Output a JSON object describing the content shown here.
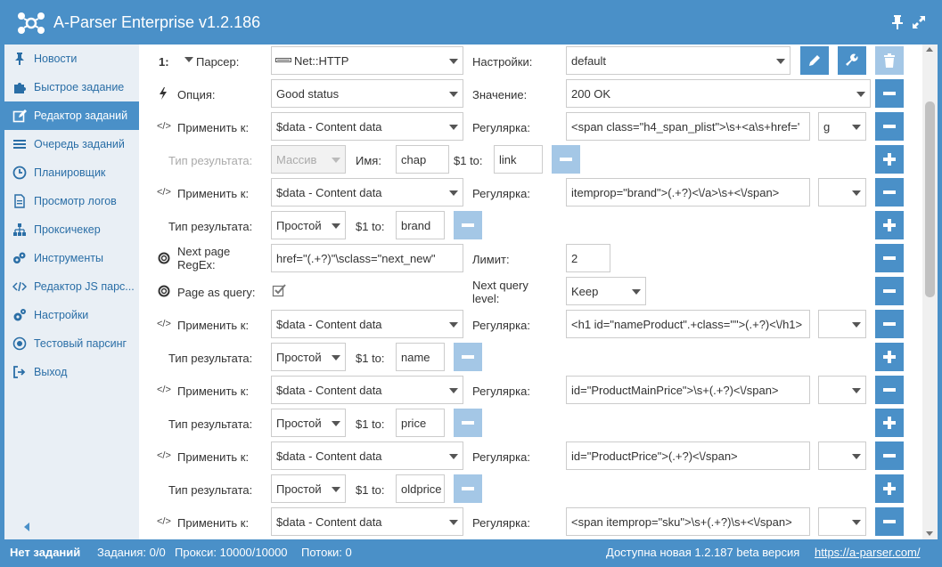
{
  "app": {
    "title": "A-Parser Enterprise v1.2.186"
  },
  "sidebar": {
    "items": [
      {
        "label": "Новости",
        "icon": "pin-icon"
      },
      {
        "label": "Быстрое задание",
        "icon": "puzzle-icon"
      },
      {
        "label": "Редактор заданий",
        "icon": "edit-icon",
        "active": true
      },
      {
        "label": "Очередь заданий",
        "icon": "list-icon"
      },
      {
        "label": "Планировщик",
        "icon": "clock-icon"
      },
      {
        "label": "Просмотр логов",
        "icon": "file-icon"
      },
      {
        "label": "Проксичекер",
        "icon": "sitemap-icon"
      },
      {
        "label": "Инструменты",
        "icon": "tools-icon"
      },
      {
        "label": "Редактор JS парс...",
        "icon": "code-icon"
      },
      {
        "label": "Настройки",
        "icon": "gears-icon"
      },
      {
        "label": "Тестовый парсинг",
        "icon": "target-icon"
      },
      {
        "label": "Выход",
        "icon": "exit-icon"
      }
    ]
  },
  "labels": {
    "number": "1:",
    "parser": "Парсер:",
    "settings": "Настройки:",
    "option": "Опция:",
    "value": "Значение:",
    "apply_to": "Применить к:",
    "regex": "Регулярка:",
    "result_type": "Тип результата:",
    "name": "Имя:",
    "s1_to": "$1 to:",
    "next_page_regex_1": "Next page",
    "next_page_regex_2": "RegEx:",
    "limit": "Лимит:",
    "page_as_query": "Page as query:",
    "next_query_level_1": "Next query",
    "next_query_level_2": "level:"
  },
  "parser": {
    "value": "Net::HTTP",
    "settings": "default"
  },
  "option": {
    "value": "Good status",
    "status": "200 OK"
  },
  "rows": {
    "r1": {
      "apply": "$data - Content data",
      "regex": "<span class=\"h4_span_plist\">\\s+<a\\s+href='",
      "flags": "g"
    },
    "r1b": {
      "type": "Массив",
      "name": "chap",
      "to": "link"
    },
    "r2": {
      "apply": "$data - Content data",
      "regex": "itemprop=\"brand\">(.+?)<\\/a>\\s+<\\/span>",
      "flags": ""
    },
    "r2b": {
      "type": "Простой",
      "to": "brand"
    },
    "next_page": {
      "regex": "href=\"(.+?)\"\\sclass=\"next_new\"",
      "limit": "2"
    },
    "page_query": {
      "level": "Keep"
    },
    "r3": {
      "apply": "$data - Content data",
      "regex": "<h1 id=\"nameProduct\".+class=\"\">(.+?)<\\/h1>",
      "flags": ""
    },
    "r3b": {
      "type": "Простой",
      "to": "name"
    },
    "r4": {
      "apply": "$data - Content data",
      "regex": "id=\"ProductMainPrice\">\\s+(.+?)<\\/span>",
      "flags": ""
    },
    "r4b": {
      "type": "Простой",
      "to": "price"
    },
    "r5": {
      "apply": "$data - Content data",
      "regex": "id=\"ProductPrice\">(.+?)<\\/span>",
      "flags": ""
    },
    "r5b": {
      "type": "Простой",
      "to": "oldprice"
    },
    "r6": {
      "apply": "$data - Content data",
      "regex": "<span itemprop=\"sku\">\\s+(.+?)\\s+<\\/span>",
      "flags": ""
    }
  },
  "status": {
    "no_tasks": "Нет заданий",
    "tasks": "Задания: 0/0",
    "proxies": "Прокси: 10000/10000",
    "threads": "Потоки: 0",
    "update": "Доступна новая 1.2.187 beta версия",
    "link": "https://a-parser.com/"
  },
  "colors": {
    "accent": "#4a90c8",
    "sidebar_bg": "#e9eff5",
    "button_light": "#a4c7e6"
  }
}
